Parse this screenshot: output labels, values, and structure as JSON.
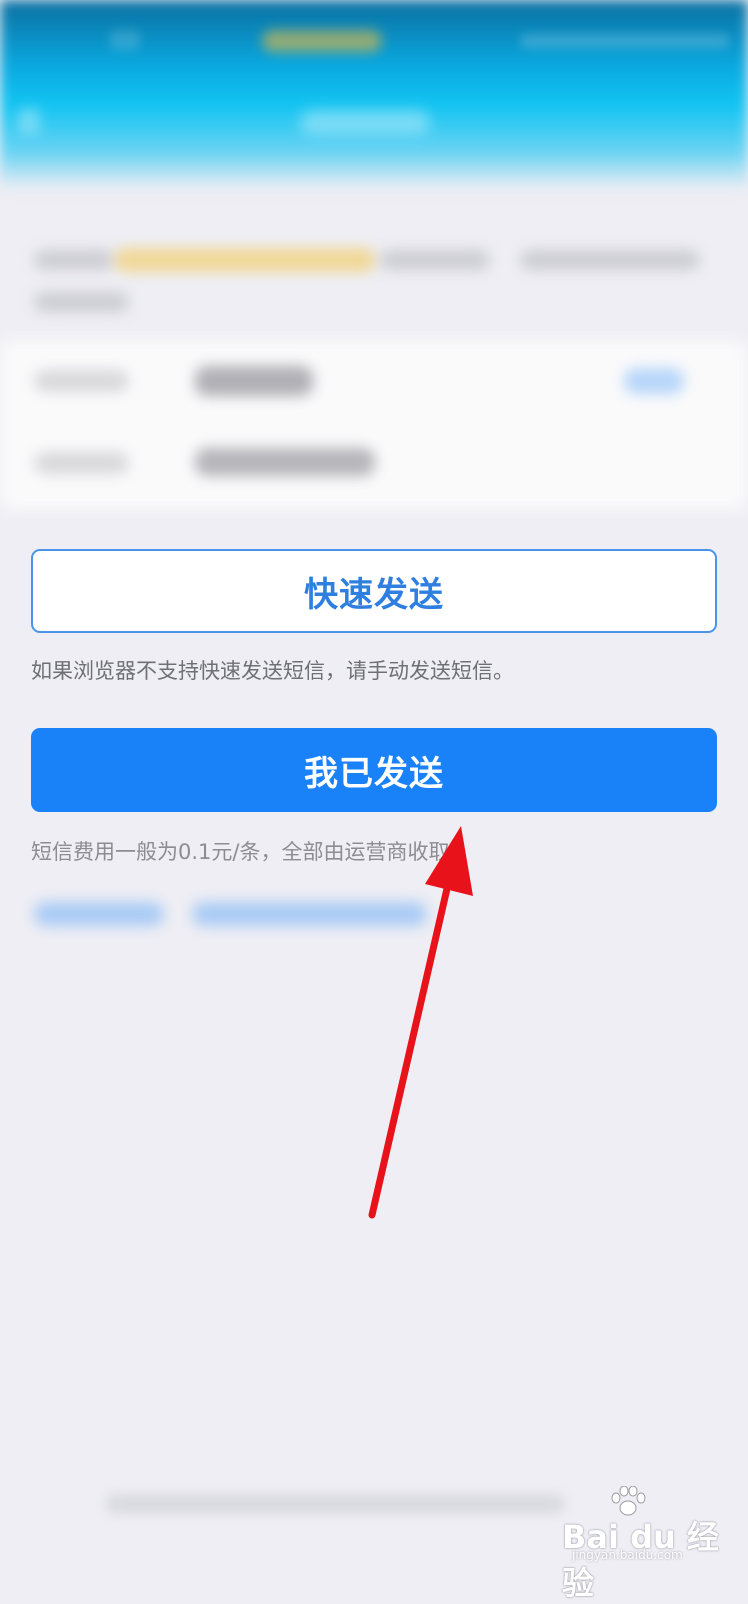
{
  "actions": {
    "quick_send_label": "快速发送",
    "quick_send_hint": "如果浏览器不支持快速发送短信，请手动发送短信。",
    "sent_label": "我已发送",
    "fee_hint": "短信费用一般为0.1元/条，全部由运营商收取。"
  },
  "watermark": {
    "brand": "Bai du 经验",
    "url": "jingyan.baidu.com"
  },
  "colors": {
    "primary": "#1a82f8",
    "primary_text": "#2f7fe0",
    "annotation_arrow": "#e8121b",
    "background": "#eeeef4"
  }
}
